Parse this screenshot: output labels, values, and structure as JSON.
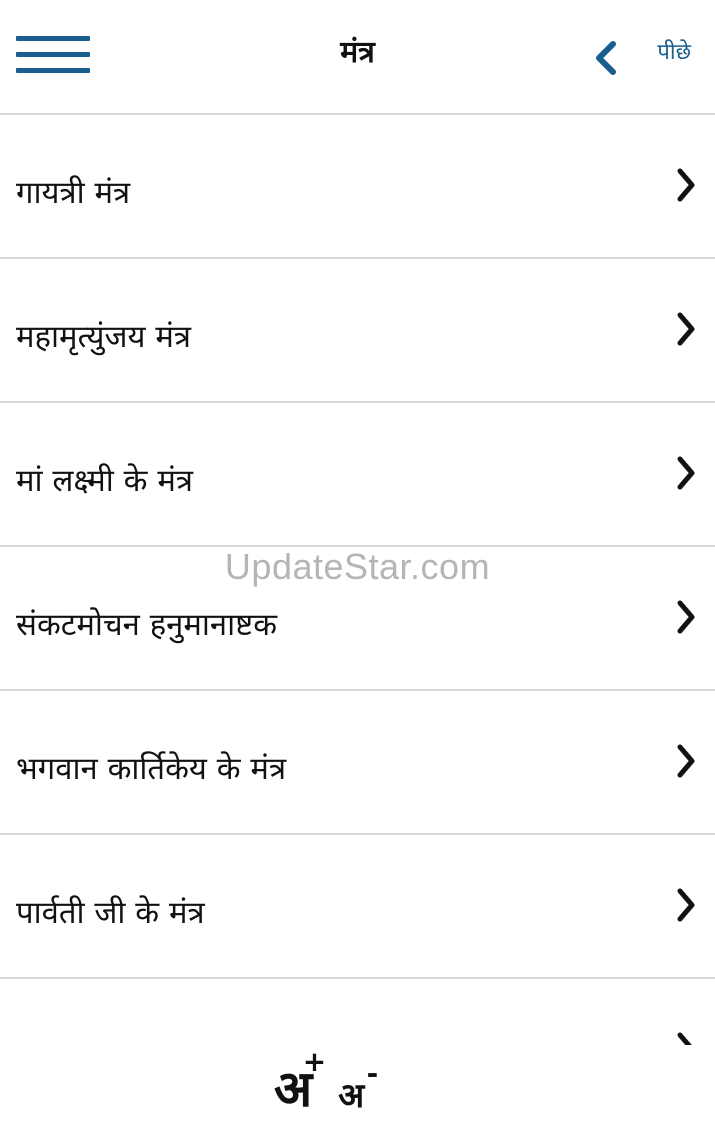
{
  "header": {
    "title": "मंत्र",
    "back_label": "पीछे"
  },
  "list": {
    "items": [
      {
        "label": "गायत्री मंत्र"
      },
      {
        "label": "महामृत्युंजय मंत्र"
      },
      {
        "label": "मां लक्ष्मी के मंत्र"
      },
      {
        "label": "संकटमोचन हनुमानाष्टक"
      },
      {
        "label": "भगवान कार्तिकेय के मंत्र"
      },
      {
        "label": "पार्वती जी के मंत्र"
      }
    ]
  },
  "watermark": "UpdateStar.com",
  "footer": {
    "increase_letter": "अ",
    "increase_sign": "+",
    "decrease_letter": "अ",
    "decrease_sign": "-"
  },
  "colors": {
    "accent": "#1a5e8f",
    "divider": "#d9d9d9",
    "text": "#111111"
  },
  "icons": {
    "menu": "hamburger-menu-icon",
    "back": "chevron-left-icon",
    "row": "chevron-right-icon"
  }
}
